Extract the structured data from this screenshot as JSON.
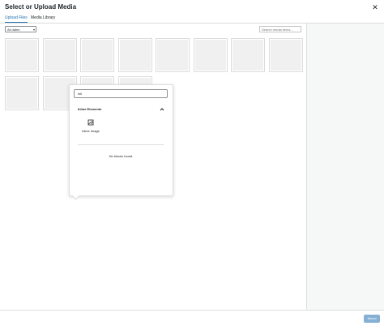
{
  "modal": {
    "title": "Select or Upload Media",
    "close_icon": "close-icon"
  },
  "tabs": [
    {
      "label": "Upload Files",
      "active": true
    },
    {
      "label": "Media Library",
      "active": false
    }
  ],
  "toolbar": {
    "date_filter": "All dates",
    "search_placeholder": "Search media items..."
  },
  "media_grid": {
    "row1_count": 8,
    "row2_count": 4
  },
  "inserter": {
    "search_value": "inli",
    "panel_title": "Inline Elements",
    "block": {
      "label": "Inline Image",
      "icon": "image-icon"
    },
    "empty_message": "No blocks found."
  },
  "footer": {
    "select_label": "Select"
  },
  "colors": {
    "accent": "#2271b1",
    "thumb_bg": "#f0f0f1",
    "sidebar_bg": "#f6f7f7"
  }
}
